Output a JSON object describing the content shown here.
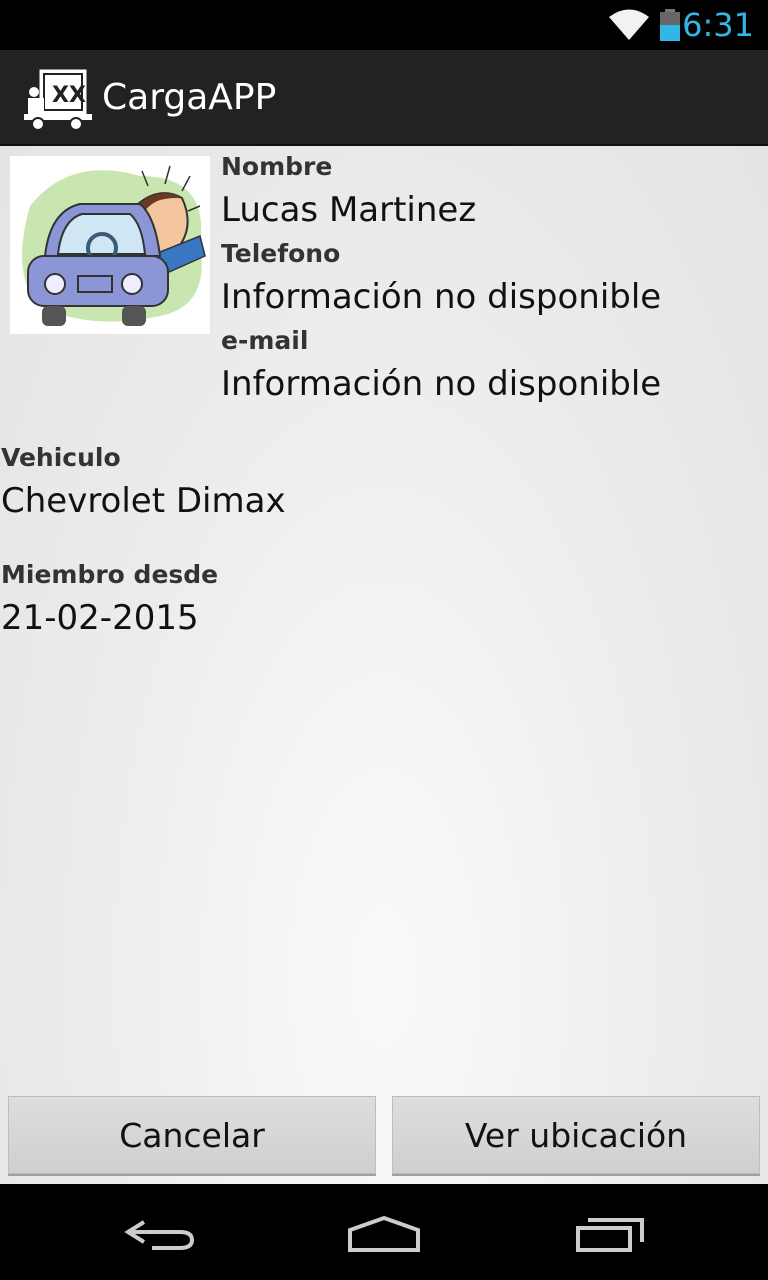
{
  "status": {
    "time": "6:31"
  },
  "app": {
    "title": "CargaAPP"
  },
  "profile": {
    "name_label": "Nombre",
    "name_value": "Lucas Martinez",
    "phone_label": "Telefono",
    "phone_value": "Información no disponible",
    "email_label": "e-mail",
    "email_value": "Información no disponible",
    "vehicle_label": "Vehiculo",
    "vehicle_value": "Chevrolet Dimax",
    "member_label": "Miembro desde",
    "member_value": "21-02-2015"
  },
  "buttons": {
    "cancel": "Cancelar",
    "location": "Ver ubicación"
  },
  "icons": {
    "wifi": "wifi-icon",
    "battery": "battery-icon",
    "back": "back-icon",
    "home": "home-icon",
    "recents": "recents-icon"
  },
  "colors": {
    "accent": "#33b5e5",
    "action_bar": "#222222"
  }
}
